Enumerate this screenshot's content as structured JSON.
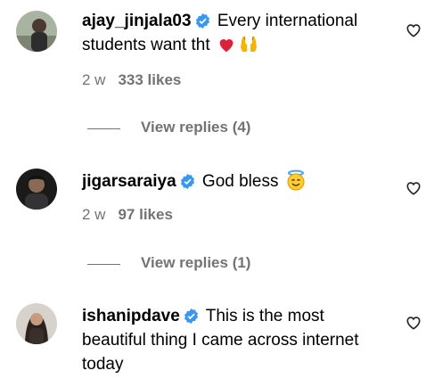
{
  "comments": [
    {
      "username": "ajay_jinjala03",
      "text": "Every international students want tht",
      "emoji": [
        "red-heart",
        "raising-hands"
      ],
      "time": "2 w",
      "likes": "333 likes",
      "view_replies": "View replies (4)",
      "verified": true
    },
    {
      "username": "jigarsaraiya",
      "text": "God bless",
      "emoji": [
        "smiling-face-with-halo"
      ],
      "time": "2 w",
      "likes": "97 likes",
      "view_replies": "View replies (1)",
      "verified": true
    },
    {
      "username": "ishanipdave",
      "text": "This is the most beautiful thing I came across internet today",
      "emoji": [],
      "verified": true
    }
  ],
  "colors": {
    "verified": "#3897f0",
    "secondary_text": "#737373",
    "heart_red": "#e0203a"
  }
}
